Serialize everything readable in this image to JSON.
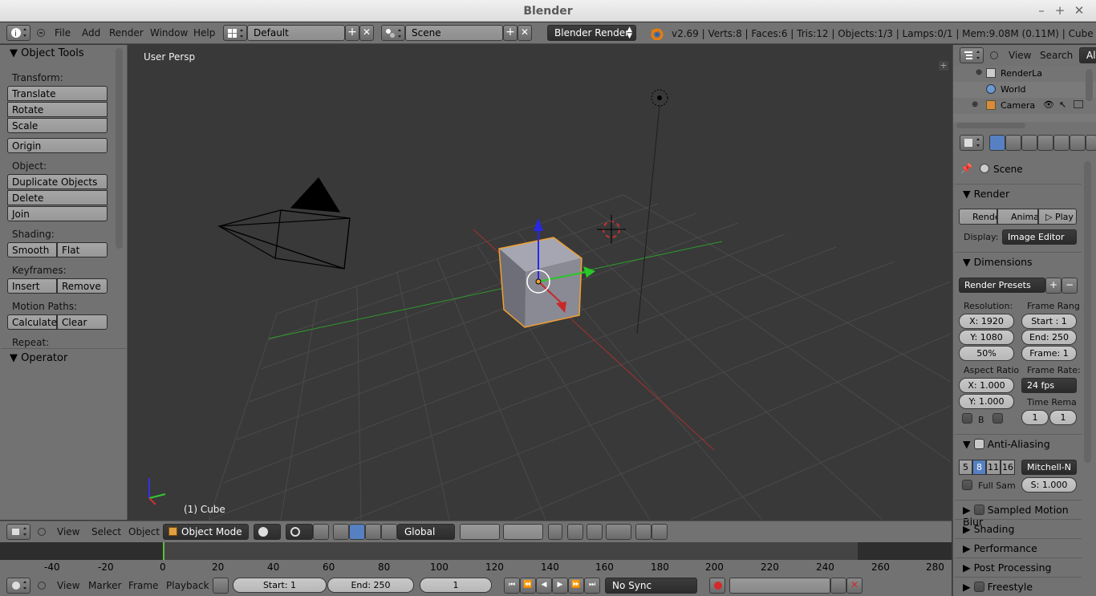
{
  "window": {
    "title": "Blender"
  },
  "info_header": {
    "menus": [
      "File",
      "Add",
      "Render",
      "Window",
      "Help"
    ],
    "screen_layout": "Default",
    "scene": "Scene",
    "render_engine": "Blender Render",
    "stats": "v2.69 | Verts:8 | Faces:6 | Tris:12 | Objects:1/3 | Lamps:0/1 | Mem:9.08M (0.11M) | Cube"
  },
  "toolshelf": {
    "title": "Object Tools",
    "transform_label": "Transform:",
    "translate": "Translate",
    "rotate": "Rotate",
    "scale": "Scale",
    "origin": "Origin",
    "object_label": "Object:",
    "duplicate": "Duplicate Objects",
    "delete": "Delete",
    "join": "Join",
    "shading_label": "Shading:",
    "smooth": "Smooth",
    "flat": "Flat",
    "keyframes_label": "Keyframes:",
    "insert": "Insert",
    "remove": "Remove",
    "motion_paths_label": "Motion Paths:",
    "calculate": "Calculate",
    "clear": "Clear",
    "repeat_label": "Repeat:",
    "operator": "Operator"
  },
  "viewport": {
    "view_name": "User Persp",
    "object_info": "(1) Cube"
  },
  "view3d_header": {
    "menus": [
      "View",
      "Select",
      "Object"
    ],
    "mode": "Object Mode",
    "orientation": "Global"
  },
  "timeline": {
    "ruler": [
      "-40",
      "-20",
      "0",
      "20",
      "40",
      "60",
      "80",
      "100",
      "120",
      "140",
      "160",
      "180",
      "200",
      "220",
      "240",
      "260",
      "280"
    ],
    "menus": [
      "View",
      "Marker",
      "Frame",
      "Playback"
    ],
    "start": "Start: 1",
    "end": "End: 250",
    "current": "1",
    "sync": "No Sync"
  },
  "outliner": {
    "menus": [
      "View",
      "Search"
    ],
    "filter": "All",
    "items": [
      "RenderLa",
      "World",
      "Camera"
    ]
  },
  "properties": {
    "context": "Scene",
    "render_panel": "Render",
    "render_btn": "Rende",
    "anim_btn": "Anima",
    "play_btn": "Play",
    "display_label": "Display:",
    "display_value": "Image Editor",
    "dimensions_panel": "Dimensions",
    "presets": "Render Presets",
    "resolution_label": "Resolution:",
    "res_x": "X: 1920",
    "res_y": "Y: 1080",
    "res_pct": "50%",
    "frame_range_label": "Frame Rang",
    "frame_start": "Start : 1",
    "frame_end": "End: 250",
    "frame_step": "Frame: 1",
    "aspect_label": "Aspect Ratio",
    "aspect_x": "X: 1.000",
    "aspect_y": "Y: 1.000",
    "framerate_label": "Frame Rate:",
    "fps": "24 fps",
    "time_remap_label": "Time Rema",
    "remap_old": "1",
    "remap_new": "1",
    "border_label": "B",
    "aa_panel": "Anti-Aliasing",
    "aa_samples": [
      "5",
      "8",
      "11",
      "16"
    ],
    "aa_filter": "Mitchell-N",
    "full_sample": "Full Sam",
    "aa_size": "S: 1.000",
    "collapsed_panels": [
      "Sampled Motion Blur",
      "Shading",
      "Performance",
      "Post Processing",
      "Freestyle"
    ]
  },
  "colors": {
    "header_bg": "#737373",
    "viewport_bg": "#393939",
    "selected_outline": "#f0a030",
    "x_axis": "#c83232",
    "y_axis": "#32c832",
    "z_axis": "#3232e6",
    "active_sample": "#5680c2"
  }
}
